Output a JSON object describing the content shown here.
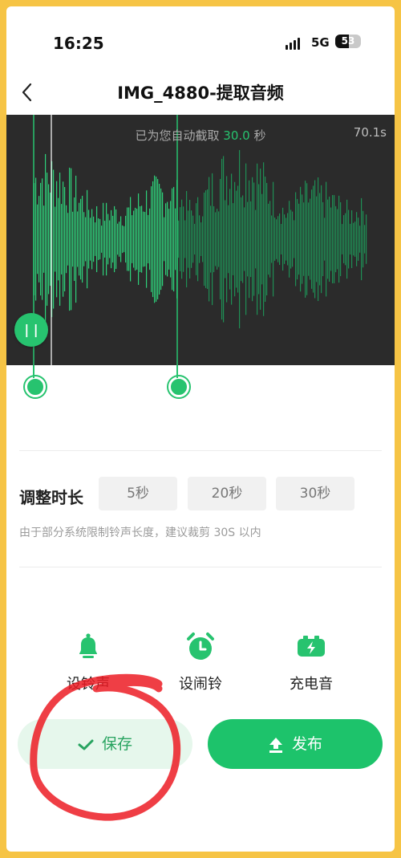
{
  "status_bar": {
    "time": "16:25",
    "network": "5G",
    "battery": "53"
  },
  "nav": {
    "back_icon": "chevron-left-icon",
    "title": "IMG_4880-提取音频"
  },
  "waveform": {
    "hint_prefix": "已为您自动截取",
    "hint_value": "30.0",
    "hint_suffix": "秒",
    "total_duration": "70.1s",
    "pause_label": "| |",
    "accent": "#27c36f"
  },
  "duration": {
    "label": "调整时长",
    "options": [
      "5秒",
      "20秒",
      "30秒"
    ],
    "note": "由于部分系统限制铃声长度，建议裁剪 30S 以内"
  },
  "actions": [
    {
      "label": "设铃声",
      "icon": "bell-icon"
    },
    {
      "label": "设闹铃",
      "icon": "alarm-clock-icon"
    },
    {
      "label": "充电音",
      "icon": "battery-charging-icon"
    }
  ],
  "buttons": {
    "save": "保存",
    "publish": "发布"
  },
  "colors": {
    "primary": "#1dc36b",
    "frame": "#f6c445",
    "annotation": "#ec1c24"
  }
}
